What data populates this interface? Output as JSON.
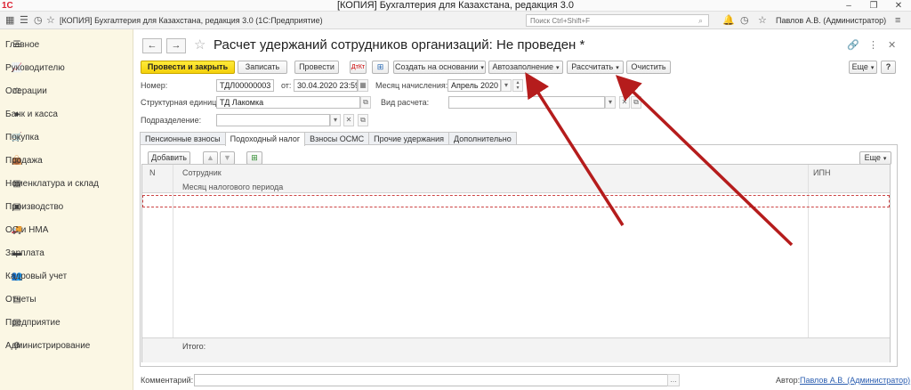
{
  "window": {
    "logo": "1С",
    "title": "[КОПИЯ] Бухгалтерия для Казахстана, редакция 3.0",
    "controls": [
      "–",
      "❐",
      "✕"
    ]
  },
  "topbar": {
    "app_title": "[КОПИЯ] Бухгалтерия для Казахстана, редакция 3.0  (1С:Предприятие)",
    "search_placeholder": "Поиск Ctrl+Shift+F",
    "user": "Павлов А.В. (Администратор)"
  },
  "sidebar": {
    "items": [
      {
        "icon": "menu-icon",
        "glyph": "☰",
        "label": "Главное"
      },
      {
        "icon": "chart-icon",
        "glyph": "📈",
        "label": "Руководителю"
      },
      {
        "icon": "operations-icon",
        "glyph": "⚖",
        "label": "Операции"
      },
      {
        "icon": "bank-icon",
        "glyph": "●",
        "label": "Банк и касса"
      },
      {
        "icon": "cart-icon",
        "glyph": "🛒",
        "label": "Покупка"
      },
      {
        "icon": "bag-icon",
        "glyph": "👜",
        "label": "Продажа"
      },
      {
        "icon": "warehouse-icon",
        "glyph": "▦",
        "label": "Номенклатура и склад"
      },
      {
        "icon": "production-icon",
        "glyph": "▣",
        "label": "Производство"
      },
      {
        "icon": "assets-icon",
        "glyph": "🚚",
        "label": "ОС и НМА"
      },
      {
        "icon": "salary-icon",
        "glyph": "▬",
        "label": "Зарплата"
      },
      {
        "icon": "hr-icon",
        "glyph": "👥",
        "label": "Кадровый учет"
      },
      {
        "icon": "reports-icon",
        "glyph": "▤",
        "label": "Отчеты"
      },
      {
        "icon": "enterprise-icon",
        "glyph": "▥",
        "label": "Предприятие"
      },
      {
        "icon": "admin-icon",
        "glyph": "⚙",
        "label": "Администрирование"
      }
    ]
  },
  "form": {
    "title": "Расчет удержаний сотрудников организаций: Не проведен *",
    "toolbar": {
      "post_close": "Провести и закрыть",
      "save": "Записать",
      "post": "Провести",
      "create_based": "Создать на основании",
      "autofill": "Автозаполнение",
      "calculate": "Рассчитать",
      "clear": "Очистить",
      "more": "Еще",
      "help": "?"
    },
    "fields": {
      "number_label": "Номер:",
      "number_value": "ТДЛ00000003",
      "date_label": "от:",
      "date_value": "30.04.2020 23:59:59",
      "period_label": "Месяц начисления:",
      "period_value": "Апрель 2020",
      "unit_label": "Структурная единица:",
      "unit_value": "ТД Лакомка",
      "calc_type_label": "Вид расчета:",
      "calc_type_value": "",
      "department_label": "Подразделение:",
      "department_value": ""
    },
    "tabs": [
      {
        "label": "Пенсионные взносы",
        "active": false
      },
      {
        "label": "Подоходный налог",
        "active": true
      },
      {
        "label": "Взносы ОСМС",
        "active": false
      },
      {
        "label": "Прочие удержания",
        "active": false
      },
      {
        "label": "Дополнительно",
        "active": false
      }
    ],
    "table": {
      "add_button": "Добавить",
      "more": "Еще",
      "col_n": "N",
      "col_employee": "Сотрудник",
      "col_period": "Месяц налогового периода",
      "col_ipn": "ИПН",
      "total_label": "Итого:"
    },
    "footer": {
      "comment_label": "Комментарий:",
      "comment_value": "",
      "author_label": "Автор:",
      "author_value": "Павлов А.В. (Администратор)"
    }
  },
  "colors": {
    "primary_button": "#f4d00a",
    "sidebar_bg": "#fbf7e4",
    "annotation_arrow": "#b51c1c"
  }
}
